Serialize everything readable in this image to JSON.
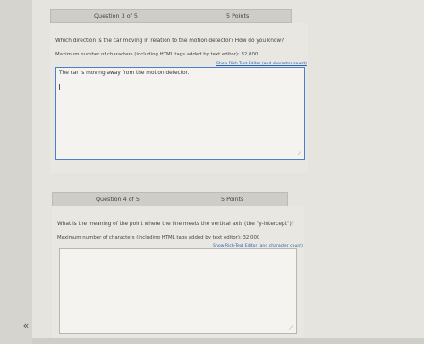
{
  "questions": [
    {
      "header": "Question 3 of 5",
      "points": "5 Points",
      "prompt": "Which direction is the car moving in relation to the motion detector? How do you know?",
      "max_chars": "Maximum number of characters (including HTML tags added by text editor): 32,000",
      "rich_text_link": "Show Rich-Text Editor (and character count)",
      "answer": "The car is moving away from the motion detector."
    },
    {
      "header": "Question 4 of 5",
      "points": "5 Points",
      "prompt": "What is the meaning of the point where the line meets the vertical axis (the \"y-intercept\")?",
      "max_chars": "Maximum number of characters (including HTML tags added by text editor): 32,000",
      "rich_text_link": "Show Rich-Text Editor (and character count)",
      "answer": ""
    }
  ],
  "sidebar": {
    "collapse_label": "«"
  }
}
